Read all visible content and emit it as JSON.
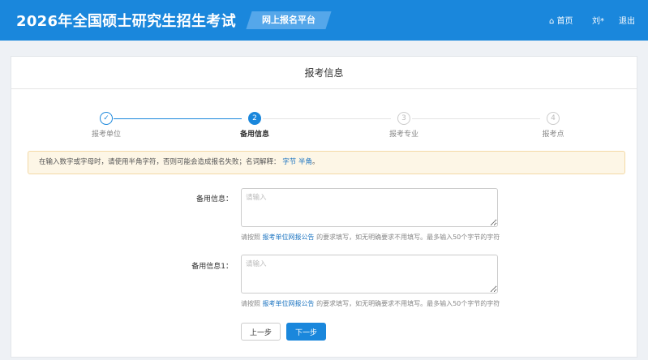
{
  "header": {
    "title": "2026年全国硕士研究生招生考试",
    "badge": "网上报名平台",
    "home": "首页",
    "user": "刘*",
    "logout": "退出"
  },
  "card": {
    "title": "报考信息"
  },
  "steps": [
    {
      "num": "✓",
      "label": "报考单位"
    },
    {
      "num": "2",
      "label": "备用信息"
    },
    {
      "num": "3",
      "label": "报考专业"
    },
    {
      "num": "4",
      "label": "报考点"
    }
  ],
  "alert": {
    "text": "在输入数字或字母时，请使用半角字符，否则可能会造成报名失败；名词解释：",
    "link1": "字节",
    "link2": "半角",
    "end": "。"
  },
  "fields": [
    {
      "label": "备用信息：",
      "placeholder": "请输入",
      "hint_pre": "请按照 ",
      "hint_link": "报考单位网报公告",
      "hint_post": " 的要求填写，如无明确要求不用填写。最多输入50个字节的字符"
    },
    {
      "label": "备用信息1：",
      "placeholder": "请输入",
      "hint_pre": "请按照 ",
      "hint_link": "报考单位网报公告",
      "hint_post": " 的要求填写，如无明确要求不用填写。最多输入50个字节的字符"
    }
  ],
  "buttons": {
    "prev": "上一步",
    "next": "下一步"
  },
  "colors": {
    "primary": "#1a87dc"
  }
}
